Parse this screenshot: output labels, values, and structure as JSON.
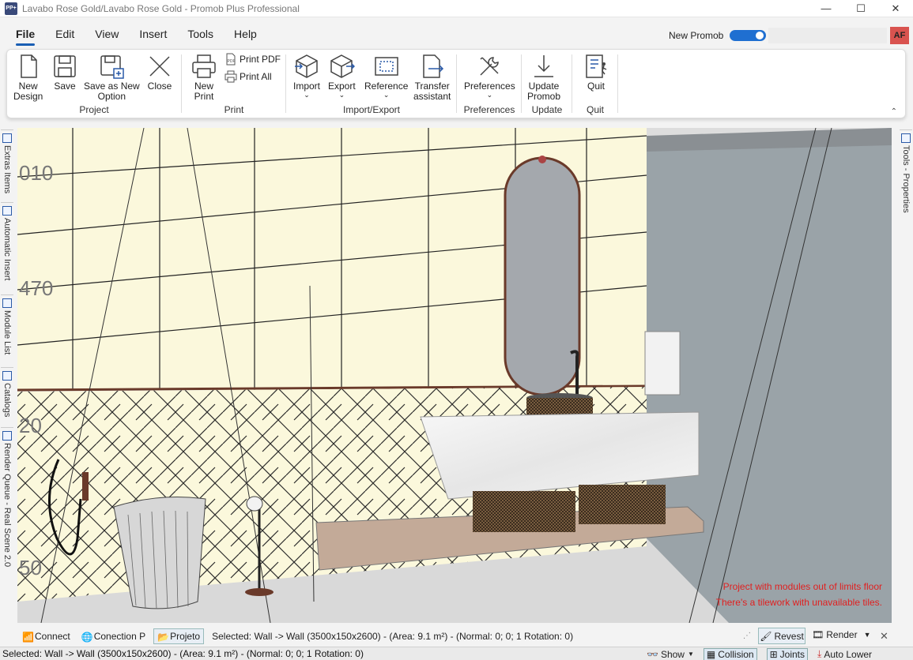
{
  "window": {
    "title": "Lavabo Rose Gold/Lavabo Rose Gold - Promob Plus Professional",
    "app_icon_text": "PP+",
    "minimize": "—",
    "maximize": "☐",
    "close": "✕"
  },
  "menu": {
    "items": [
      "File",
      "Edit",
      "View",
      "Insert",
      "Tools",
      "Help"
    ],
    "active": "File",
    "new_promob_label": "New Promob",
    "new_promob_on": true,
    "user_initials": "AF"
  },
  "ribbon": {
    "groups": {
      "project": "Project",
      "print": "Print",
      "import_export": "Import/Export",
      "preferences": "Preferences",
      "update": "Update",
      "quit": "Quit"
    },
    "buttons": {
      "new_design": [
        "New",
        "Design"
      ],
      "save": "Save",
      "save_as_new_option": [
        "Save as New",
        "Option"
      ],
      "close": "Close",
      "new_print": [
        "New",
        "Print"
      ],
      "print_pdf": "Print PDF",
      "print_all": "Print All",
      "import": "Import",
      "export": "Export",
      "reference": "Reference",
      "transfer_assistant": [
        "Transfer",
        "assistant"
      ],
      "preferences": "Preferences",
      "update_promob": [
        "Update",
        "Promob"
      ],
      "quit": "Quit"
    },
    "collapse": "⌃"
  },
  "left_tabs": [
    "Extras Items",
    "Automatic Insert",
    "Module List",
    "Catalogs",
    "Render Queue - Real Scene 2.0"
  ],
  "right_tabs": [
    "Tools - Properties"
  ],
  "viewport": {
    "dimension_labels": [
      "010",
      "470",
      "20",
      "50"
    ],
    "warnings": [
      "Project with modules out of limits floor",
      "There's a tilework with unavailable tiles."
    ],
    "colors": {
      "wall_tile": "#fbf8dc",
      "side_wall": "#9aa3a8",
      "floor": "#dcdcdc",
      "marble": "#f2f2f2",
      "shelf": "#c3aa98",
      "warning": "#e02020"
    }
  },
  "status": {
    "connect": "Connect",
    "connection": "Conection P",
    "projeto": "Projeto",
    "selected": "Selected: Wall -> Wall (3500x150x2600) - (Area: 9.1 m²) - (Normal: 0; 0; 1 Rotation: 0)",
    "revest": "Revest",
    "render": "Render",
    "close": "✕"
  },
  "status2": {
    "selected": "Selected: Wall -> Wall (3500x150x2600) - (Area: 9.1 m²) - (Normal: 0; 0; 1 Rotation: 0)",
    "show": "Show",
    "collision": "Collision",
    "joints": "Joints",
    "auto_lower": "Auto Lower"
  }
}
